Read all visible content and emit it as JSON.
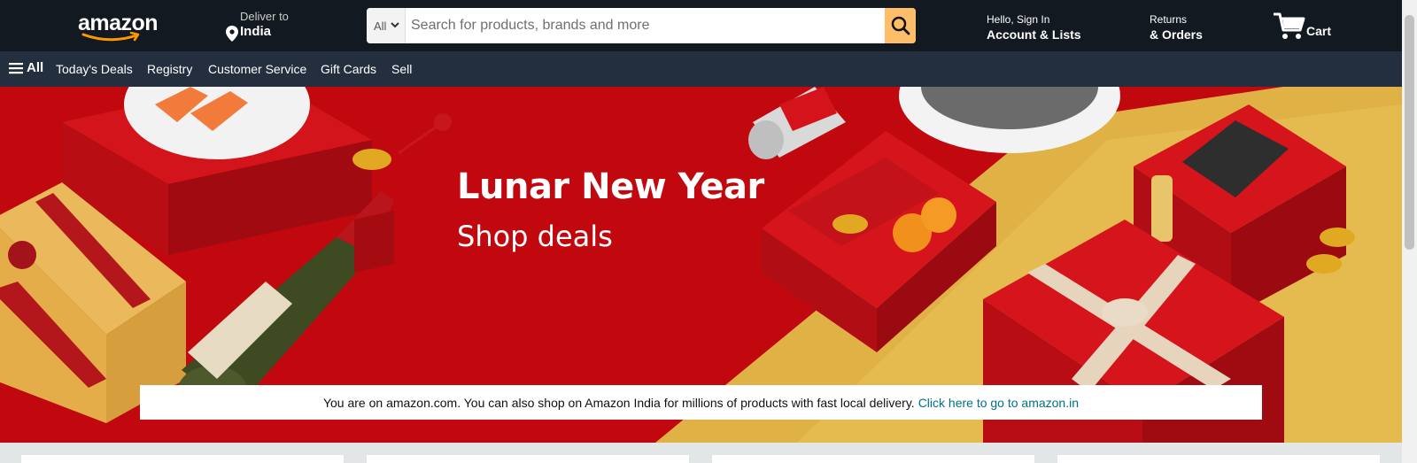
{
  "header": {
    "logo": "amazon",
    "deliver": {
      "line1": "Deliver to",
      "line2": "India"
    },
    "search": {
      "category": "All",
      "placeholder": "Search for products, brands and more"
    },
    "account": {
      "line1": "Hello, Sign In",
      "line2": "Account & Lists"
    },
    "returns": {
      "line1": "Returns",
      "line2": "& Orders"
    },
    "cart": {
      "label": "Cart"
    }
  },
  "subnav": {
    "all": "All",
    "items": [
      "Today's Deals",
      "Registry",
      "Customer Service",
      "Gift Cards",
      "Sell"
    ]
  },
  "hero": {
    "title": "Lunar New Year",
    "subtitle": "Shop deals"
  },
  "notice": {
    "text": "You are on amazon.com. You can also shop on Amazon India for millions of products with fast local delivery.",
    "link": "Click here to go to amazon.in"
  },
  "colors": {
    "topnav": "#131921",
    "subnav": "#232f3e",
    "search_button": "#febd69",
    "link": "#007185",
    "hero_red": "#c1080f",
    "hero_gold": "#e5b84a"
  },
  "icons": [
    "location-pin-icon",
    "search-icon",
    "chevron-down-icon",
    "cart-icon",
    "hamburger-icon"
  ]
}
